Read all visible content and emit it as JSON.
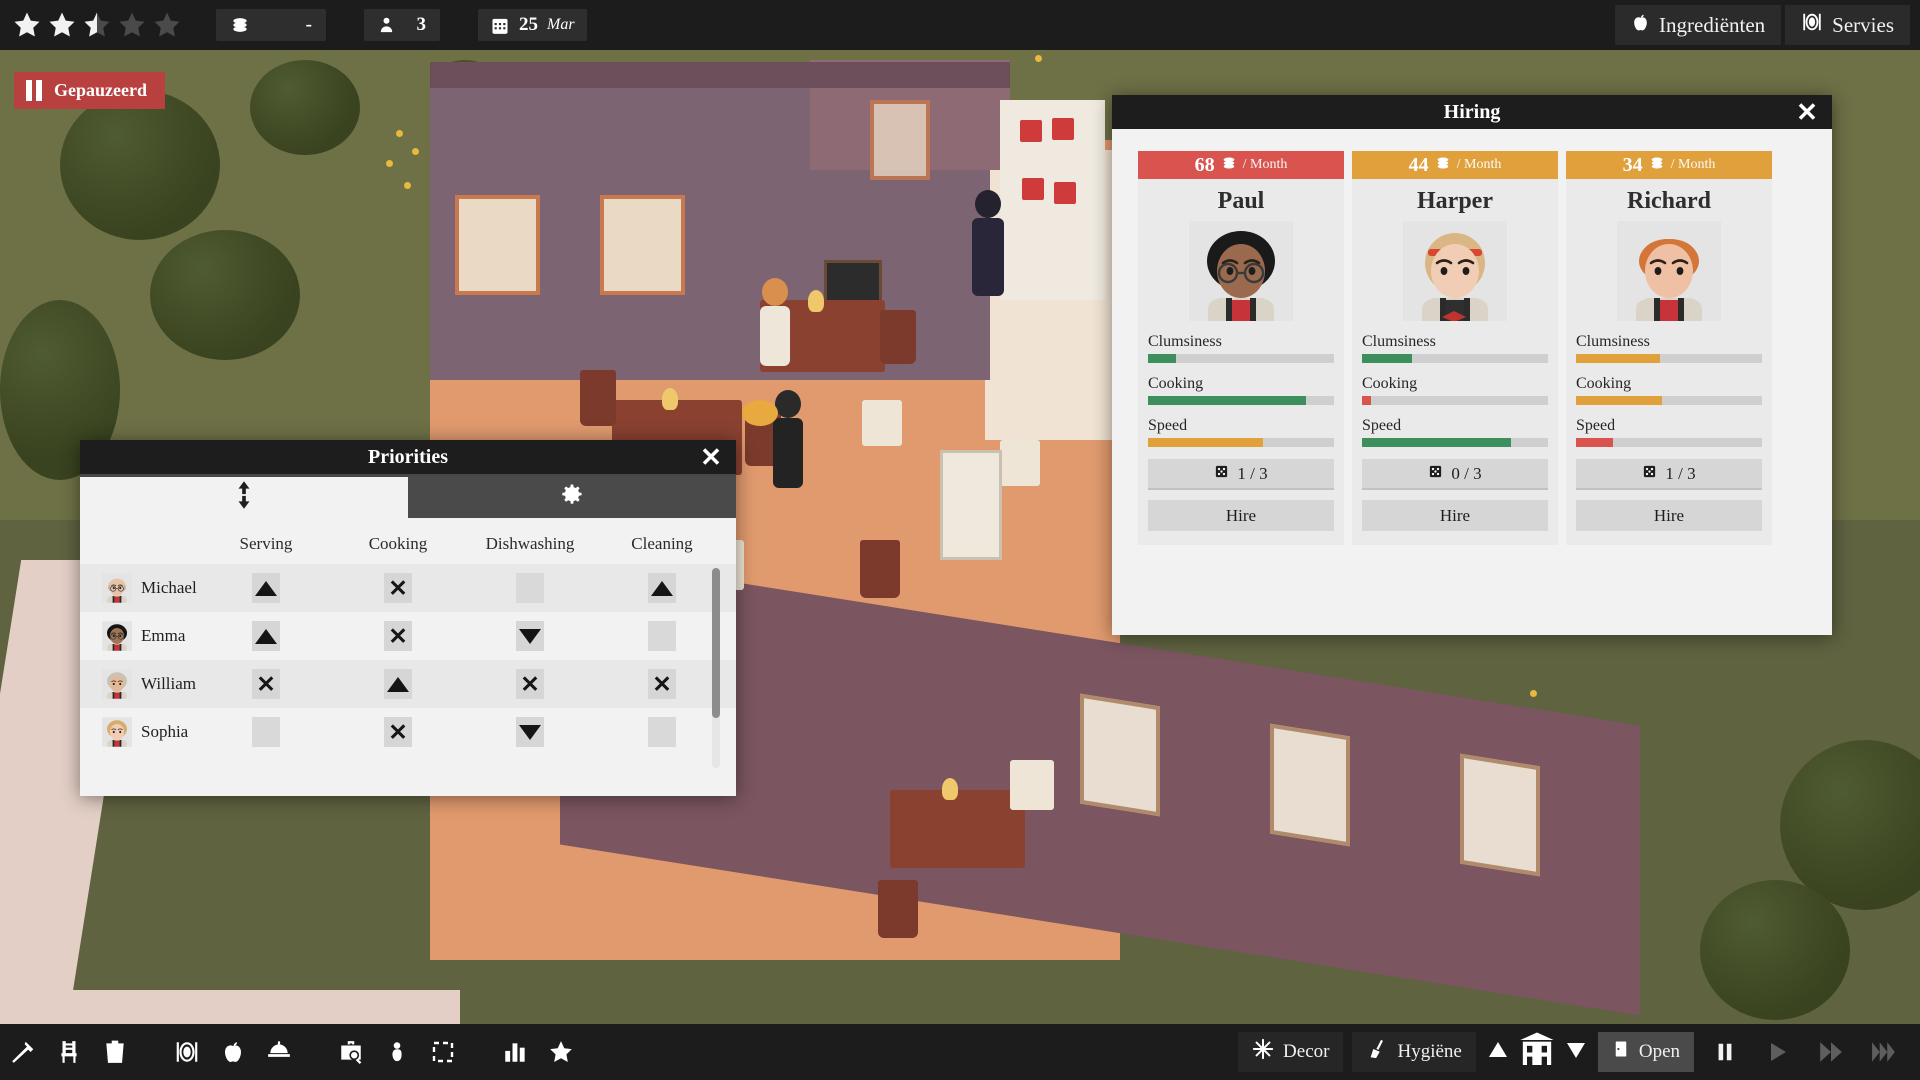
{
  "topbar": {
    "rating": {
      "name": "star-rating",
      "filled": 2,
      "half": 1,
      "total": 5
    },
    "money": {
      "icon": "coins-icon",
      "value": "-"
    },
    "guests": {
      "icon": "person-icon",
      "value": "3"
    },
    "date": {
      "icon": "calendar-icon",
      "day": "25",
      "month": "Mar"
    },
    "buttons": [
      {
        "icon": "apple-icon",
        "label": "Ingrediënten"
      },
      {
        "icon": "plate-cutlery-icon",
        "label": "Servies"
      }
    ]
  },
  "pause_banner": {
    "icon": "pause-icon",
    "label": "Gepauzeerd"
  },
  "hiring": {
    "title": "Hiring",
    "close_label": "✕",
    "per_month_label": "/ Month",
    "stat_labels": [
      "Clumsiness",
      "Cooking",
      "Speed"
    ],
    "hire_label": "Hire",
    "experience_icon": "dice-icon",
    "coin_icon": "coins-icon",
    "candidates": [
      {
        "name": "Paul",
        "salary": "68",
        "salary_color": "#d9534f",
        "experience": "1 / 3",
        "stats": [
          {
            "label": "Clumsiness",
            "value": 15,
            "color": "#3d8f5d"
          },
          {
            "label": "Cooking",
            "value": 85,
            "color": "#3d8f5d"
          },
          {
            "label": "Speed",
            "value": 62,
            "color": "#e0a03c"
          }
        ],
        "portrait": {
          "hair": "#1a1a1a",
          "skin": "#9b6a4e",
          "shirt": "#c6343a",
          "glasses": true,
          "hair_style": "afro"
        }
      },
      {
        "name": "Harper",
        "salary": "44",
        "salary_color": "#e0a03c",
        "experience": "0 / 3",
        "stats": [
          {
            "label": "Clumsiness",
            "value": 27,
            "color": "#3d8f5d"
          },
          {
            "label": "Cooking",
            "value": 5,
            "color": "#d9534f"
          },
          {
            "label": "Speed",
            "value": 80,
            "color": "#3d8f5d"
          }
        ],
        "portrait": {
          "hair": "#d9b683",
          "skin": "#f0cdb4",
          "shirt": "#2f2f2f",
          "glasses": false,
          "hair_style": "bob"
        }
      },
      {
        "name": "Richard",
        "salary": "34",
        "salary_color": "#e0a03c",
        "experience": "1 / 3",
        "stats": [
          {
            "label": "Clumsiness",
            "value": 45,
            "color": "#e0a03c"
          },
          {
            "label": "Cooking",
            "value": 46,
            "color": "#e0a03c"
          },
          {
            "label": "Speed",
            "value": 20,
            "color": "#d9534f"
          }
        ],
        "portrait": {
          "hair": "#d4763a",
          "skin": "#f0c0a4",
          "shirt": "#c6343a",
          "glasses": false,
          "hair_style": "short"
        }
      }
    ]
  },
  "priorities": {
    "title": "Priorities",
    "close_label": "✕",
    "tabs": [
      {
        "icon": "up-down-arrows-icon",
        "active": true
      },
      {
        "icon": "gear-icon",
        "active": false
      }
    ],
    "columns": [
      "Serving",
      "Cooking",
      "Dishwashing",
      "Cleaning"
    ],
    "rows": [
      {
        "name": "Michael",
        "avatar": {
          "hair": "#b9b2a8",
          "skin": "#e8c4a6",
          "shirt": "#c6343a",
          "glasses": true,
          "bald": true
        },
        "values": [
          "up",
          "x",
          "none",
          "up"
        ]
      },
      {
        "name": "Emma",
        "avatar": {
          "hair": "#141414",
          "skin": "#a07455",
          "shirt": "#c6343a",
          "glasses": true,
          "bald": false
        },
        "values": [
          "up",
          "x",
          "down",
          "none"
        ]
      },
      {
        "name": "William",
        "avatar": {
          "hair": "#c9c2b6",
          "skin": "#e3b998",
          "shirt": "#c6343a",
          "glasses": false,
          "bald": false
        },
        "values": [
          "x",
          "up",
          "x",
          "x"
        ]
      },
      {
        "name": "Sophia",
        "avatar": {
          "hair": "#d8ad6b",
          "skin": "#f0cdb4",
          "shirt": "#c6343a",
          "glasses": false,
          "bald": false
        },
        "values": [
          "none",
          "x",
          "down",
          "none"
        ]
      }
    ]
  },
  "bottombar": {
    "tools": [
      {
        "icon": "hammer-icon",
        "name": "build-tool"
      },
      {
        "icon": "chair-icon",
        "name": "furniture-tool"
      },
      {
        "icon": "trash-icon",
        "name": "delete-tool"
      }
    ],
    "catalog": [
      {
        "icon": "plate-cutlery-icon",
        "name": "tableware-button"
      },
      {
        "icon": "apple-icon",
        "name": "ingredients-button"
      },
      {
        "icon": "cloche-icon",
        "name": "menu-button"
      }
    ],
    "staff": [
      {
        "icon": "briefcase-search-icon",
        "name": "hiring-button"
      },
      {
        "icon": "staff-icon",
        "name": "staff-button"
      },
      {
        "icon": "selection-box-icon",
        "name": "select-tool"
      }
    ],
    "stats": [
      {
        "icon": "bar-chart-icon",
        "name": "statistics-button"
      },
      {
        "icon": "star-icon",
        "name": "reputation-button"
      }
    ],
    "decor": {
      "icon": "snowflake-icon",
      "label": "Decor"
    },
    "hygiene": {
      "icon": "broom-icon",
      "label": "Hygiëne"
    },
    "floor": {
      "up_icon": "triangle-up-icon",
      "building_icon": "building-icon",
      "down_icon": "triangle-down-icon"
    },
    "open": {
      "icon": "door-icon",
      "label": "Open"
    },
    "speed": [
      {
        "icon": "pause-icon",
        "name": "speed-pause",
        "active": true
      },
      {
        "icon": "play-icon",
        "name": "speed-play",
        "active": false
      },
      {
        "icon": "fast-forward-icon",
        "name": "speed-fast",
        "active": false
      },
      {
        "icon": "fastest-forward-icon",
        "name": "speed-fastest",
        "active": false
      }
    ]
  }
}
